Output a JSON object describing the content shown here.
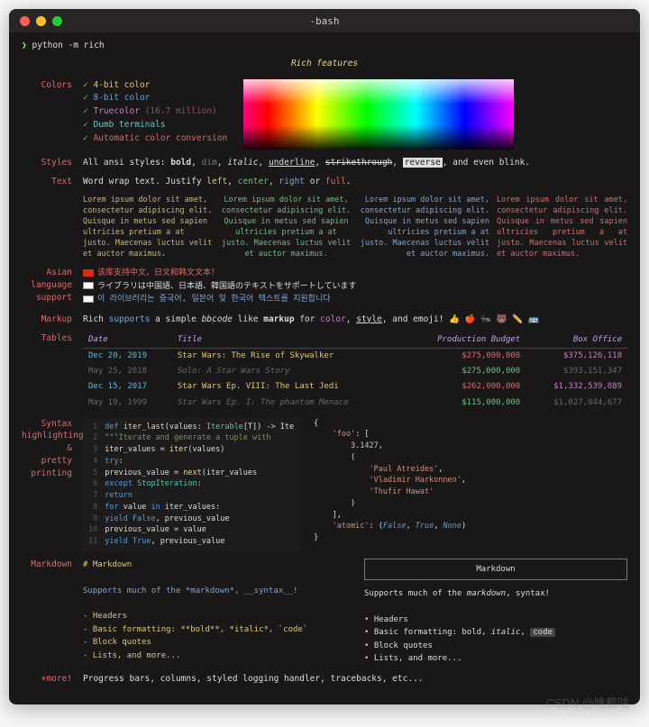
{
  "window": {
    "title": "-bash"
  },
  "prompt": {
    "char": "❯",
    "cmd": "python -m rich"
  },
  "heading": "Rich features",
  "labels": {
    "colors": "Colors",
    "styles": "Styles",
    "text": "Text",
    "asian": "Asian\nlanguage\nsupport",
    "markup": "Markup",
    "tables": "Tables",
    "syntax": "Syntax\nhighlighting\n&\npretty\nprinting",
    "markdown": "Markdown",
    "more": "+more!"
  },
  "colors": [
    {
      "label": "4-bit color",
      "cls": "item-yel"
    },
    {
      "label": "8-bit color",
      "cls": "item-blu"
    },
    {
      "label": "Truecolor",
      "paren": "(16.7 million)",
      "cls": "item-mag"
    },
    {
      "label": "Dumb terminals",
      "cls": "item-cya"
    },
    {
      "label": "Automatic color conversion",
      "cls": "item-red"
    }
  ],
  "styles": {
    "pre": "All ansi styles: ",
    "bold": "bold",
    "dim": "dim",
    "italic": "italic",
    "underline": "underline",
    "strike": "strikethrough",
    "reverse": "reverse",
    "post": ", and even blink."
  },
  "text": {
    "line": "Word wrap text. Justify ",
    "left": "left",
    "center": "center",
    "right": "right",
    "full": "full",
    "or": " or ",
    "dot": "."
  },
  "lorem": "Lorem ipsum dolor sit amet, consectetur adipiscing elit. Quisque in metus sed sapien ultricies pretium a at justo. Maecenas luctus velit et auctor maximus.",
  "asian": {
    "cn": "该库支持中文，日文和韩文文本！",
    "jp": "ライブラリは中国語、日本語、韓国語のテキストをサポートしています",
    "kr": "이 라이브러리는 중국어, 일본어 및 한국어 텍스트를 지원합니다"
  },
  "markup": {
    "pre": "Rich ",
    "sup": "supports",
    "mid": " a simple ",
    "bb": "bbcode",
    "like": " like ",
    "mk": "markup",
    "for": " for ",
    "color": "color",
    "style": "style",
    "emj": ", and emoji! 👍 🍎 🐜 🐻 ✏️ 🚌"
  },
  "table": {
    "headers": [
      "Date",
      "Title",
      "Production Budget",
      "Box Office"
    ],
    "rows": [
      {
        "d": "Dec 20, 2019",
        "t": "Star Wars: The Rise of Skywalker",
        "b": "$275,000,000",
        "o": "$375,126,118",
        "cls": "rd"
      },
      {
        "d": "May 25, 2018",
        "t": "Solo: A Star Wars Story",
        "b": "$275,000,000",
        "o": "$393,151,347",
        "cls": "re"
      },
      {
        "d": "Dec 15, 2017",
        "t": "Star Wars Ep. VIII: The Last Jedi",
        "b": "$262,000,000",
        "o": "$1,332,539,889",
        "cls": "rd"
      },
      {
        "d": "May 19, 1999",
        "t": "Star Wars Ep. I: The phantom Menace",
        "b": "$115,000,000",
        "o": "$1,027,044,677",
        "cls": "re"
      }
    ]
  },
  "code": {
    "lines": [
      "<span class='kw'>def</span> <span class='fn'>iter_last</span>(values: <span class='ty'>Iterable</span>[T]) -&gt; Ite",
      "    <span class='cm'>\"\"\"Iterate and generate a tuple with</span>",
      "    iter_values = <span class='fn'>iter</span>(values)",
      "    <span class='kw'>try</span>:",
      "        previous_value = <span class='fn'>next</span>(iter_values",
      "    <span class='kw'>except</span> <span class='ty'>StopIteration</span>:",
      "        <span class='kw'>return</span>",
      "    <span class='kw'>for</span> value <span class='kw'>in</span> iter_values:",
      "        <span class='kw'>yield</span> <span class='jb'>False</span>, previous_value",
      "        previous_value = value",
      "    <span class='kw'>yield</span> <span class='jb'>True</span>, previous_value"
    ]
  },
  "json": {
    "l1": "{",
    "l2": "'foo'",
    "l3": "3.1427",
    "l4": "(",
    "l5": "'Paul Atreides'",
    "l6": "'Vladimir Harkonnen'",
    "l7": "'Thufir Hawat'",
    "l8": ")",
    "l9": "],",
    "l10": "'atomic'",
    "false": "False",
    "true": "True",
    "none": "None",
    "l11": "}"
  },
  "md": {
    "h": "# Markdown",
    "p": "Supports much of the *markdown*, __syntax__!",
    "items": [
      "- Headers",
      "- Basic formatting: **bold**, *italic*, `code`",
      "- Block quotes",
      "- Lists, and more..."
    ],
    "boxtitle": "Markdown",
    "rp": "Supports much of the ",
    "rmd": "markdown",
    "rsy": ", syntax!",
    "ritems": [
      "Headers",
      "Basic formatting: bold, <i>italic</i>, <span class='codeinl'>code</span>",
      "Block quotes",
      "Lists, and more..."
    ]
  },
  "more": "Progress bars, columns, styled logging handler, tracebacks, etc...",
  "watermark": "CSDN @啥都咕"
}
